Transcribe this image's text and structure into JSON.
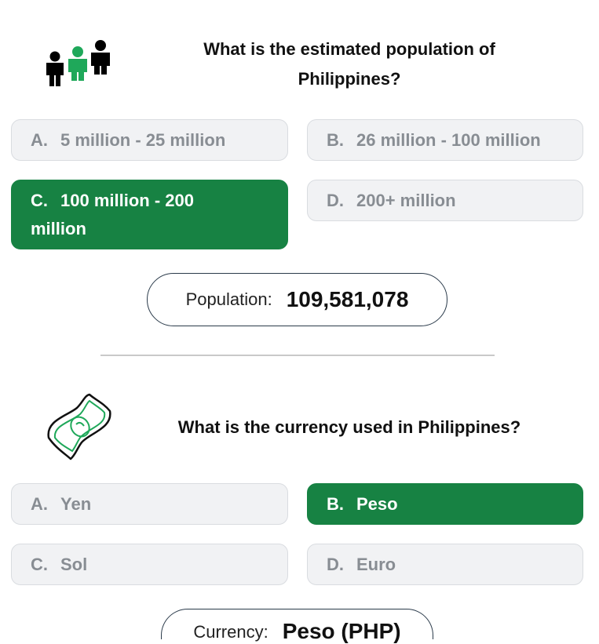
{
  "population_quiz": {
    "icon": "people-icon",
    "question_line1": "What is the estimated population of",
    "question_line2": "Philippines?",
    "options": [
      {
        "letter": "A.",
        "text": "5 million - 25 million"
      },
      {
        "letter": "B.",
        "text": "26 million - 100 million"
      },
      {
        "letter": "C.",
        "text": "100 million - 200",
        "text2": "million"
      },
      {
        "letter": "D.",
        "text": "200+ million"
      }
    ],
    "result_label": "Population:",
    "result_value": "109,581,078"
  },
  "currency_quiz": {
    "icon": "money-bill-icon",
    "question": "What is the currency used in Philippines?",
    "options": [
      {
        "letter": "A.",
        "text": "Yen"
      },
      {
        "letter": "B.",
        "text": "Peso"
      },
      {
        "letter": "C.",
        "text": "Sol"
      },
      {
        "letter": "D.",
        "text": "Euro"
      }
    ],
    "result_label": "Currency:",
    "result_value": "Peso (PHP)"
  },
  "colors": {
    "selected": "#178243",
    "option_bg": "#f1f2f4",
    "option_text": "#888d93",
    "icon_green": "#1fa85a"
  }
}
